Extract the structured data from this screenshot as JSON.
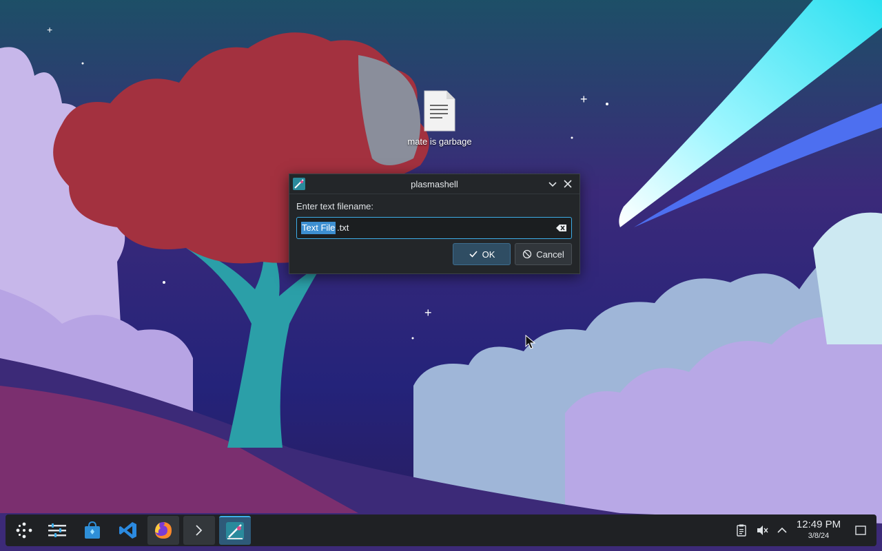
{
  "desktop": {
    "file_icon": {
      "icon": "text-file-icon",
      "label": "mate is garbage"
    }
  },
  "dialog": {
    "title": "plasmashell",
    "prompt": "Enter text filename:",
    "input": {
      "selected_text": "Text File",
      "remaining_text": ".txt"
    },
    "ok_label": "OK",
    "cancel_label": "Cancel"
  },
  "taskbar": {
    "items": [
      {
        "name": "application-launcher",
        "icon": "kde-launcher-icon"
      },
      {
        "name": "system-settings",
        "icon": "settings-sliders-icon"
      },
      {
        "name": "discover",
        "icon": "store-bag-icon"
      },
      {
        "name": "vscode",
        "icon": "vscode-icon"
      },
      {
        "name": "firefox",
        "icon": "firefox-icon"
      },
      {
        "name": "konsole",
        "icon": "terminal-icon"
      },
      {
        "name": "plasmashell",
        "icon": "plasmashell-icon"
      }
    ],
    "clock": {
      "time": "12:49 PM",
      "date": "3/8/24"
    }
  },
  "colors": {
    "accent": "#3daee9",
    "dialog_bg": "#232629",
    "taskbar_bg": "#1f2124"
  }
}
